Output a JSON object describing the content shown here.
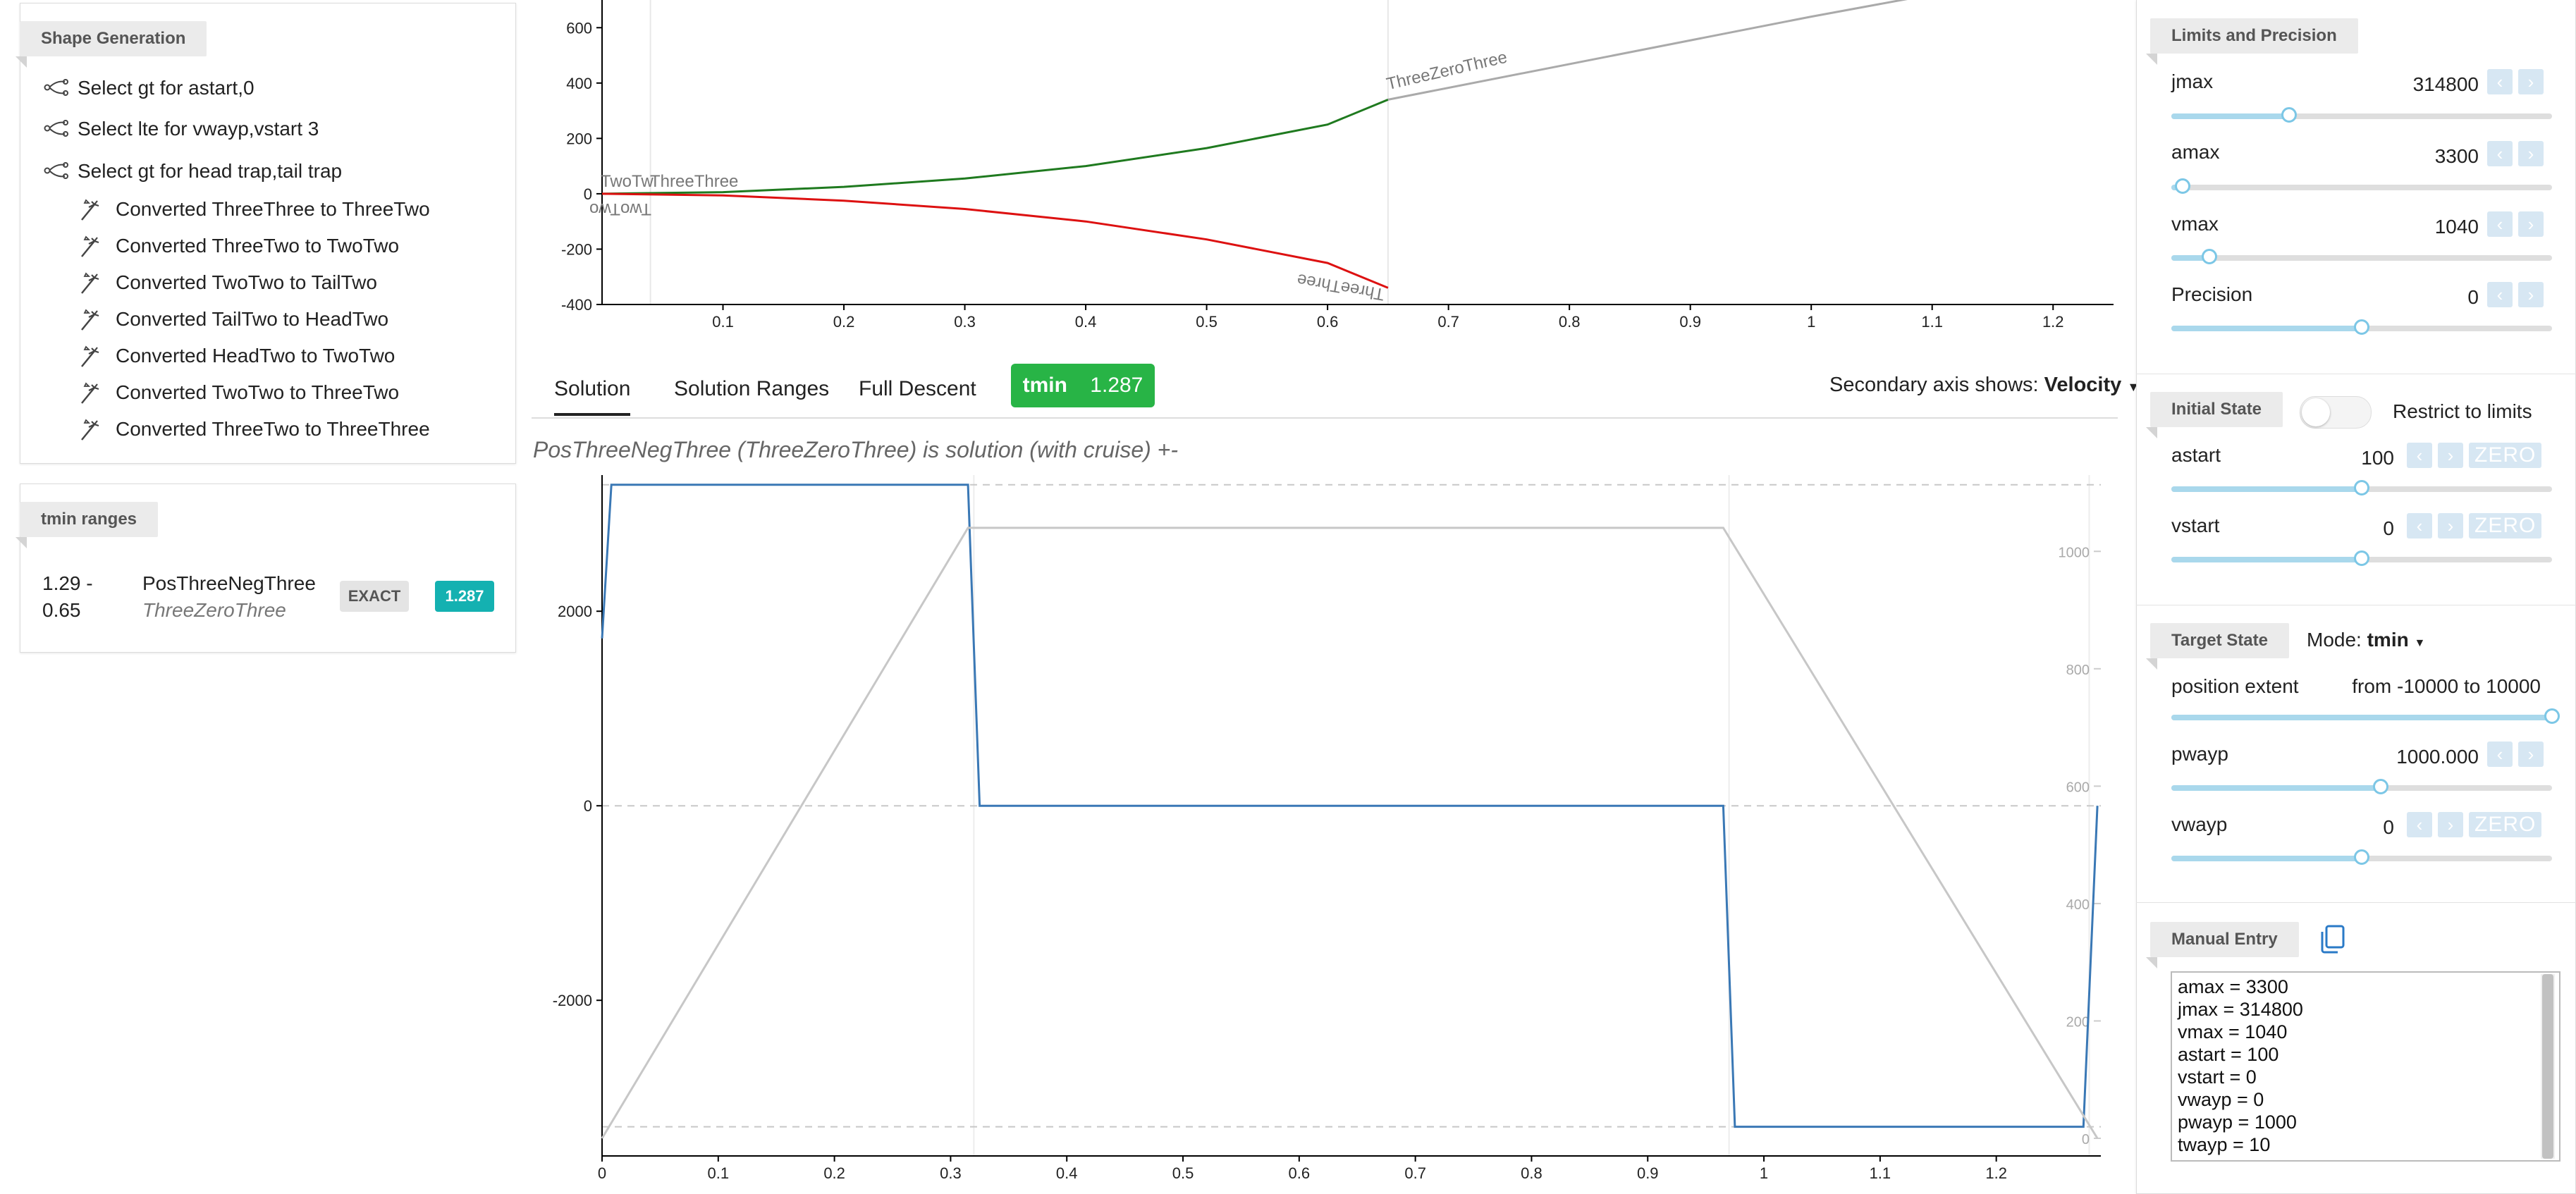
{
  "shape_generation": {
    "title": "Shape Generation",
    "selections": [
      "Select gt for astart,0",
      "Select lte for vwayp,vstart 3",
      "Select gt for head trap,tail trap"
    ],
    "conversions": [
      "Converted ThreeThree to ThreeTwo",
      "Converted ThreeTwo to TwoTwo",
      "Converted TwoTwo to TailTwo",
      "Converted TailTwo to HeadTwo",
      "Converted HeadTwo to TwoTwo",
      "Converted TwoTwo to ThreeTwo",
      "Converted ThreeTwo to ThreeThree"
    ]
  },
  "tmin_ranges": {
    "title": "tmin ranges",
    "range_top": "1.29 -",
    "range_bottom": "0.65",
    "name": "PosThreeNegThree",
    "subname": "ThreeZeroThree",
    "exact_label": "EXACT",
    "value_badge": "1.287"
  },
  "tabs": {
    "solution": "Solution",
    "solution_ranges": "Solution Ranges",
    "full_descent": "Full Descent",
    "tmin_label": "tmin",
    "tmin_value": "1.287",
    "secondary_prefix": "Secondary axis shows:",
    "secondary_value": "Velocity",
    "subtitle": "PosThreeNegThree (ThreeZeroThree) is solution (with cruise) +-"
  },
  "top_chart": {
    "labels": {
      "three_zero_three": "ThreeZeroThree",
      "two_tw": "TwoTw",
      "three_three": "ThreeThree",
      "two_two_flipped": "TwoTwo",
      "three_three_flipped": "ThreeThree"
    }
  },
  "limits": {
    "title": "Limits and Precision",
    "jmax_label": "jmax",
    "jmax_value": "314800",
    "amax_label": "amax",
    "amax_value": "3300",
    "vmax_label": "vmax",
    "vmax_value": "1040",
    "precision_label": "Precision",
    "precision_value": "0"
  },
  "initial_state": {
    "title": "Initial State",
    "restrict_label": "Restrict to limits",
    "astart_label": "astart",
    "astart_value": "100",
    "vstart_label": "vstart",
    "vstart_value": "0",
    "zero_label": "ZERO"
  },
  "target_state": {
    "title": "Target State",
    "mode_prefix": "Mode:",
    "mode_value": "tmin",
    "extent_label": "position extent",
    "extent_value": "from -10000 to 10000",
    "pwayp_label": "pwayp",
    "pwayp_value": "1000.000",
    "vwayp_label": "vwayp",
    "vwayp_value": "0",
    "zero_label": "ZERO"
  },
  "manual_entry": {
    "title": "Manual Entry",
    "lines": [
      "amax = 3300",
      "jmax = 314800",
      "vmax = 1040",
      "astart = 100",
      "vstart = 0",
      "vwayp = 0",
      "pwayp = 1000",
      "twayp = 10"
    ]
  },
  "slider_levels": {
    "jmax": 0.31,
    "amax": 0.03,
    "vmax": 0.1,
    "precision": 0.5,
    "astart": 0.5,
    "vstart": 0.5,
    "extent": 1.0,
    "pwayp": 0.55,
    "vwayp": 0.5
  },
  "chart_data": [
    {
      "type": "line",
      "x": [
        0,
        0.1,
        0.2,
        0.3,
        0.4,
        0.5,
        0.6,
        0.7,
        0.8,
        0.9,
        1.0,
        1.1,
        1.2
      ],
      "ylim": [
        -400,
        700
      ],
      "xlim": [
        0,
        1.25
      ],
      "yticks": [
        -400,
        -200,
        0,
        200,
        400,
        600
      ],
      "xticks": [
        0.1,
        0.2,
        0.3,
        0.4,
        0.5,
        0.6,
        0.7,
        0.8,
        0.9,
        1.0,
        1.1,
        1.2
      ],
      "series": [
        {
          "color": "#1f7a1f",
          "points": [
            [
              0,
              0
            ],
            [
              0.1,
              6
            ],
            [
              0.2,
              25
            ],
            [
              0.3,
              55
            ],
            [
              0.4,
              100
            ],
            [
              0.5,
              165
            ],
            [
              0.6,
              250
            ],
            [
              0.65,
              340
            ]
          ]
        },
        {
          "color": "#dd1111",
          "points": [
            [
              0,
              0
            ],
            [
              0.1,
              -6
            ],
            [
              0.2,
              -25
            ],
            [
              0.3,
              -55
            ],
            [
              0.4,
              -100
            ],
            [
              0.5,
              -165
            ],
            [
              0.6,
              -250
            ],
            [
              0.65,
              -340
            ]
          ]
        },
        {
          "color": "#aaaaaa",
          "points": [
            [
              0.65,
              340
            ],
            [
              1.0,
              640
            ],
            [
              1.1,
              720
            ]
          ]
        }
      ],
      "vlines": [
        0.04,
        0.65
      ],
      "grid": false
    },
    {
      "type": "line",
      "x": [
        0,
        0.1,
        0.2,
        0.3,
        0.4,
        0.5,
        0.6,
        0.7,
        0.8,
        0.9,
        1.0,
        1.1,
        1.2
      ],
      "xlim": [
        0,
        1.29
      ],
      "ylim": [
        -3600,
        3400
      ],
      "yticks": [
        -2000,
        0,
        2000
      ],
      "xticks": [
        0,
        0.1,
        0.2,
        0.3,
        0.4,
        0.5,
        0.6,
        0.7,
        0.8,
        0.9,
        1.0,
        1.1,
        1.2
      ],
      "secondary_ylim": [
        -30,
        1130
      ],
      "secondary_yticks": [
        0,
        200,
        400,
        600,
        800,
        1000
      ],
      "series": [
        {
          "color": "#3a78b5",
          "axis": "primary",
          "points": [
            [
              0,
              1720
            ],
            [
              0.008,
              3300
            ],
            [
              0.315,
              3300
            ],
            [
              0.325,
              0
            ],
            [
              0.965,
              0
            ],
            [
              0.975,
              -3300
            ],
            [
              1.275,
              -3300
            ],
            [
              1.287,
              0
            ]
          ]
        },
        {
          "color": "#c7c7c7",
          "axis": "secondary",
          "points": [
            [
              0,
              0
            ],
            [
              0.315,
              1040
            ],
            [
              0.965,
              1040
            ],
            [
              1.287,
              0
            ]
          ]
        }
      ],
      "hlines_primary": [
        3300,
        0,
        -3300
      ],
      "vlines": [
        0.32,
        0.97,
        1.28
      ],
      "grid": false
    }
  ]
}
